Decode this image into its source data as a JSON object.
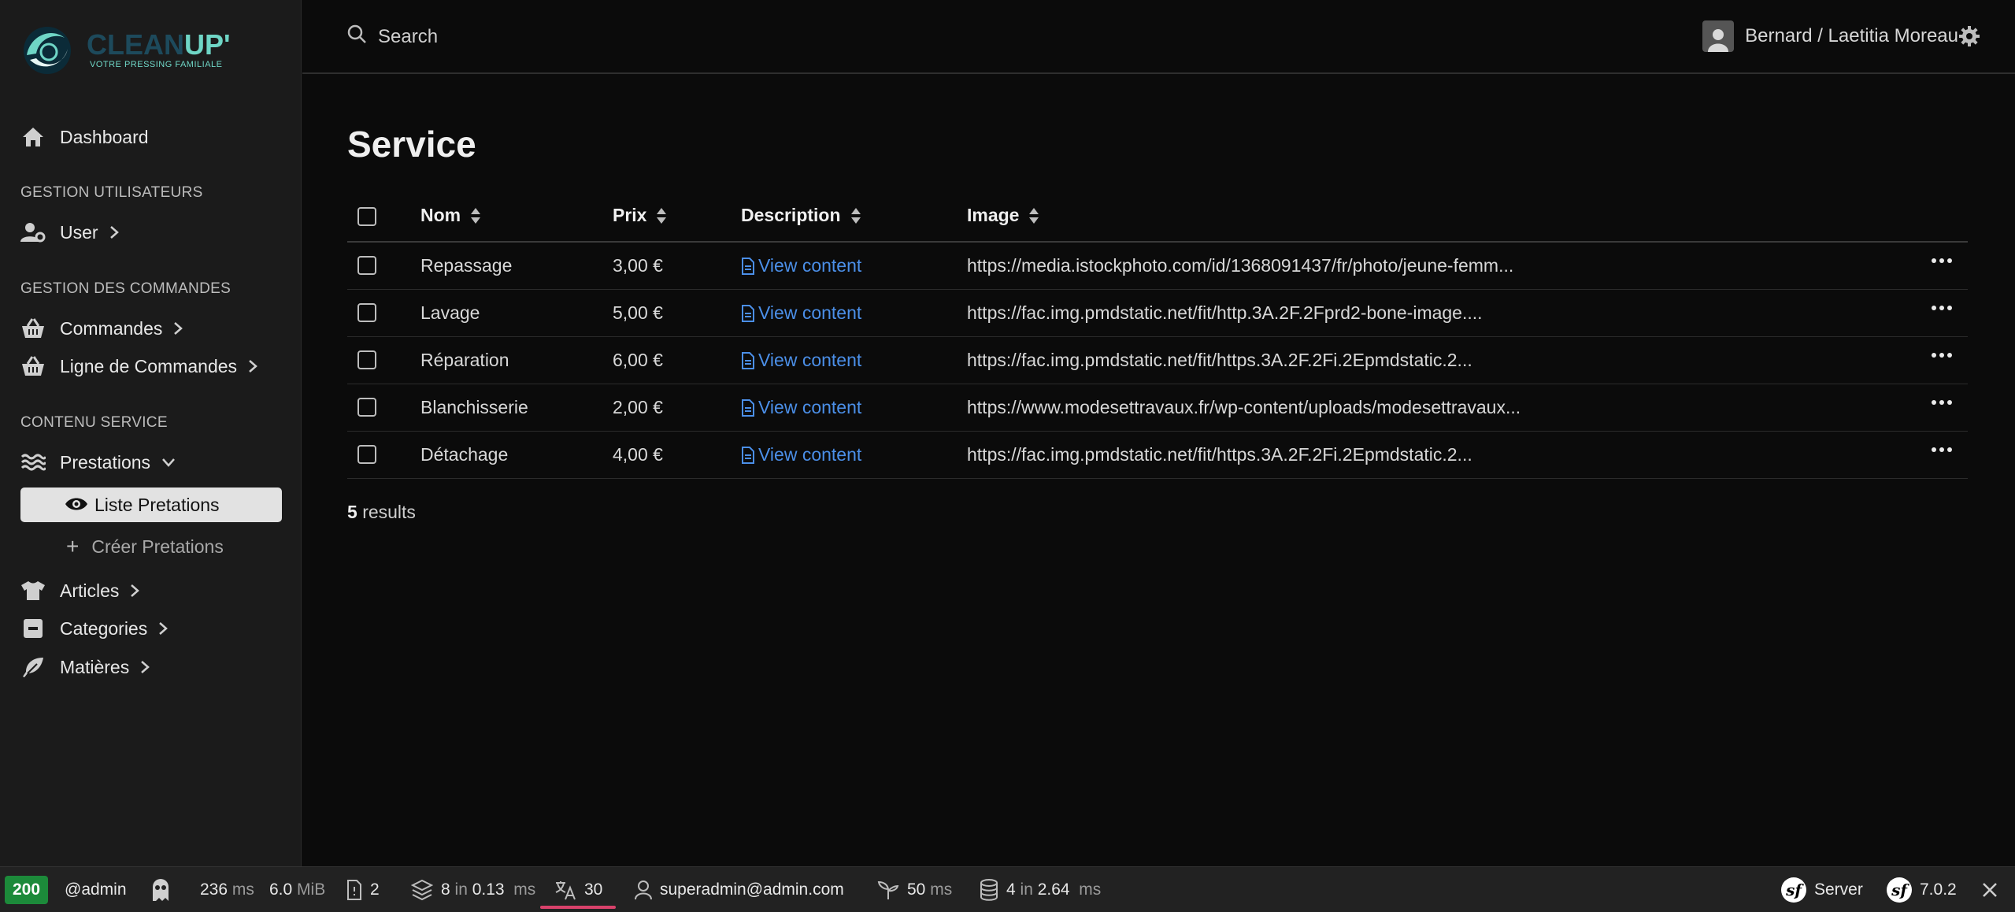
{
  "brand": {
    "name_part1": "CLEAN",
    "name_part2": "UP'",
    "tagline": "VOTRE PRESSING FAMILIALE"
  },
  "sidebar": {
    "dashboard": "Dashboard",
    "section_users": "GESTION UTILISATEURS",
    "user": "User",
    "section_orders": "GESTION DES COMMANDES",
    "orders": "Commandes",
    "order_lines": "Ligne de Commandes",
    "section_service": "CONTENU SERVICE",
    "prestations": "Prestations",
    "list_prestations": "Liste Pretations",
    "create_prestations": "Créer Pretations",
    "articles": "Articles",
    "categories": "Categories",
    "materials": "Matières"
  },
  "topbar": {
    "search_placeholder": "Search",
    "user_name": "Bernard / Laetitia Moreau"
  },
  "main": {
    "title": "Service",
    "columns": [
      "Nom",
      "Prix",
      "Description",
      "Image"
    ],
    "rows": [
      {
        "name": "Repassage",
        "price": "3,00 €",
        "description": "View content",
        "image": "https://media.istockphoto.com/id/1368091437/fr/photo/jeune-femm..."
      },
      {
        "name": "Lavage",
        "price": "5,00 €",
        "description": "View content",
        "image": "https://fac.img.pmdstatic.net/fit/http.3A.2F.2Fprd2-bone-image...."
      },
      {
        "name": "Réparation",
        "price": "6,00 €",
        "description": "View content",
        "image": "https://fac.img.pmdstatic.net/fit/https.3A.2F.2Fi.2Epmdstatic.2..."
      },
      {
        "name": "Blanchisserie",
        "price": "2,00 €",
        "description": "View content",
        "image": "https://www.modesettravaux.fr/wp-content/uploads/modesettravaux..."
      },
      {
        "name": "Détachage",
        "price": "4,00 €",
        "description": "View content",
        "image": "https://fac.img.pmdstatic.net/fit/https.3A.2F.2Fi.2Epmdstatic.2..."
      }
    ],
    "results_count": "5",
    "results_label": "results"
  },
  "debug_toolbar": {
    "status_code": "200",
    "route": "@admin",
    "time_value": "236",
    "time_unit": "ms",
    "memory_value": "6.0",
    "memory_unit": "MiB",
    "forms": "2",
    "cache_count": "8",
    "cache_in": "in",
    "cache_time": "0.13",
    "cache_unit": "ms",
    "translations": "30",
    "security_user": "superadmin@admin.com",
    "twig_value": "50",
    "twig_unit": "ms",
    "db_count": "4",
    "db_in": "in",
    "db_time": "2.64",
    "db_unit": "ms",
    "server": "Server",
    "symfony_version": "7.0.2"
  },
  "colors": {
    "sidebar_bg": "#1b1b1b",
    "main_bg": "#0b0b0b",
    "link": "#4b8fe8",
    "status_ok": "#1c8a3a",
    "brand_teal": "#6fd6c6"
  }
}
